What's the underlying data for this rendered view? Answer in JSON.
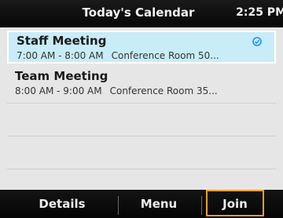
{
  "header": {
    "title": "Today's Calendar",
    "time": "2:25 PM"
  },
  "meetings": [
    {
      "subject": "Staff Meeting",
      "time": "7:00 AM - 8:00 AM",
      "location": "Conference Room 50...",
      "selected": true,
      "icon": "sync-icon"
    },
    {
      "subject": "Team Meeting",
      "time": "8:00 AM - 9:00 AM",
      "location": "Conference Room 35...",
      "selected": false
    }
  ],
  "softkeys": [
    {
      "label": "Details"
    },
    {
      "label": "Menu"
    },
    {
      "label": "Join",
      "highlighted": true
    }
  ],
  "colors": {
    "selected_row": "#c8ecf8",
    "list_bg": "#e6e6e6",
    "focus_border": "#f0a020",
    "icon_blue": "#1e90ff"
  }
}
